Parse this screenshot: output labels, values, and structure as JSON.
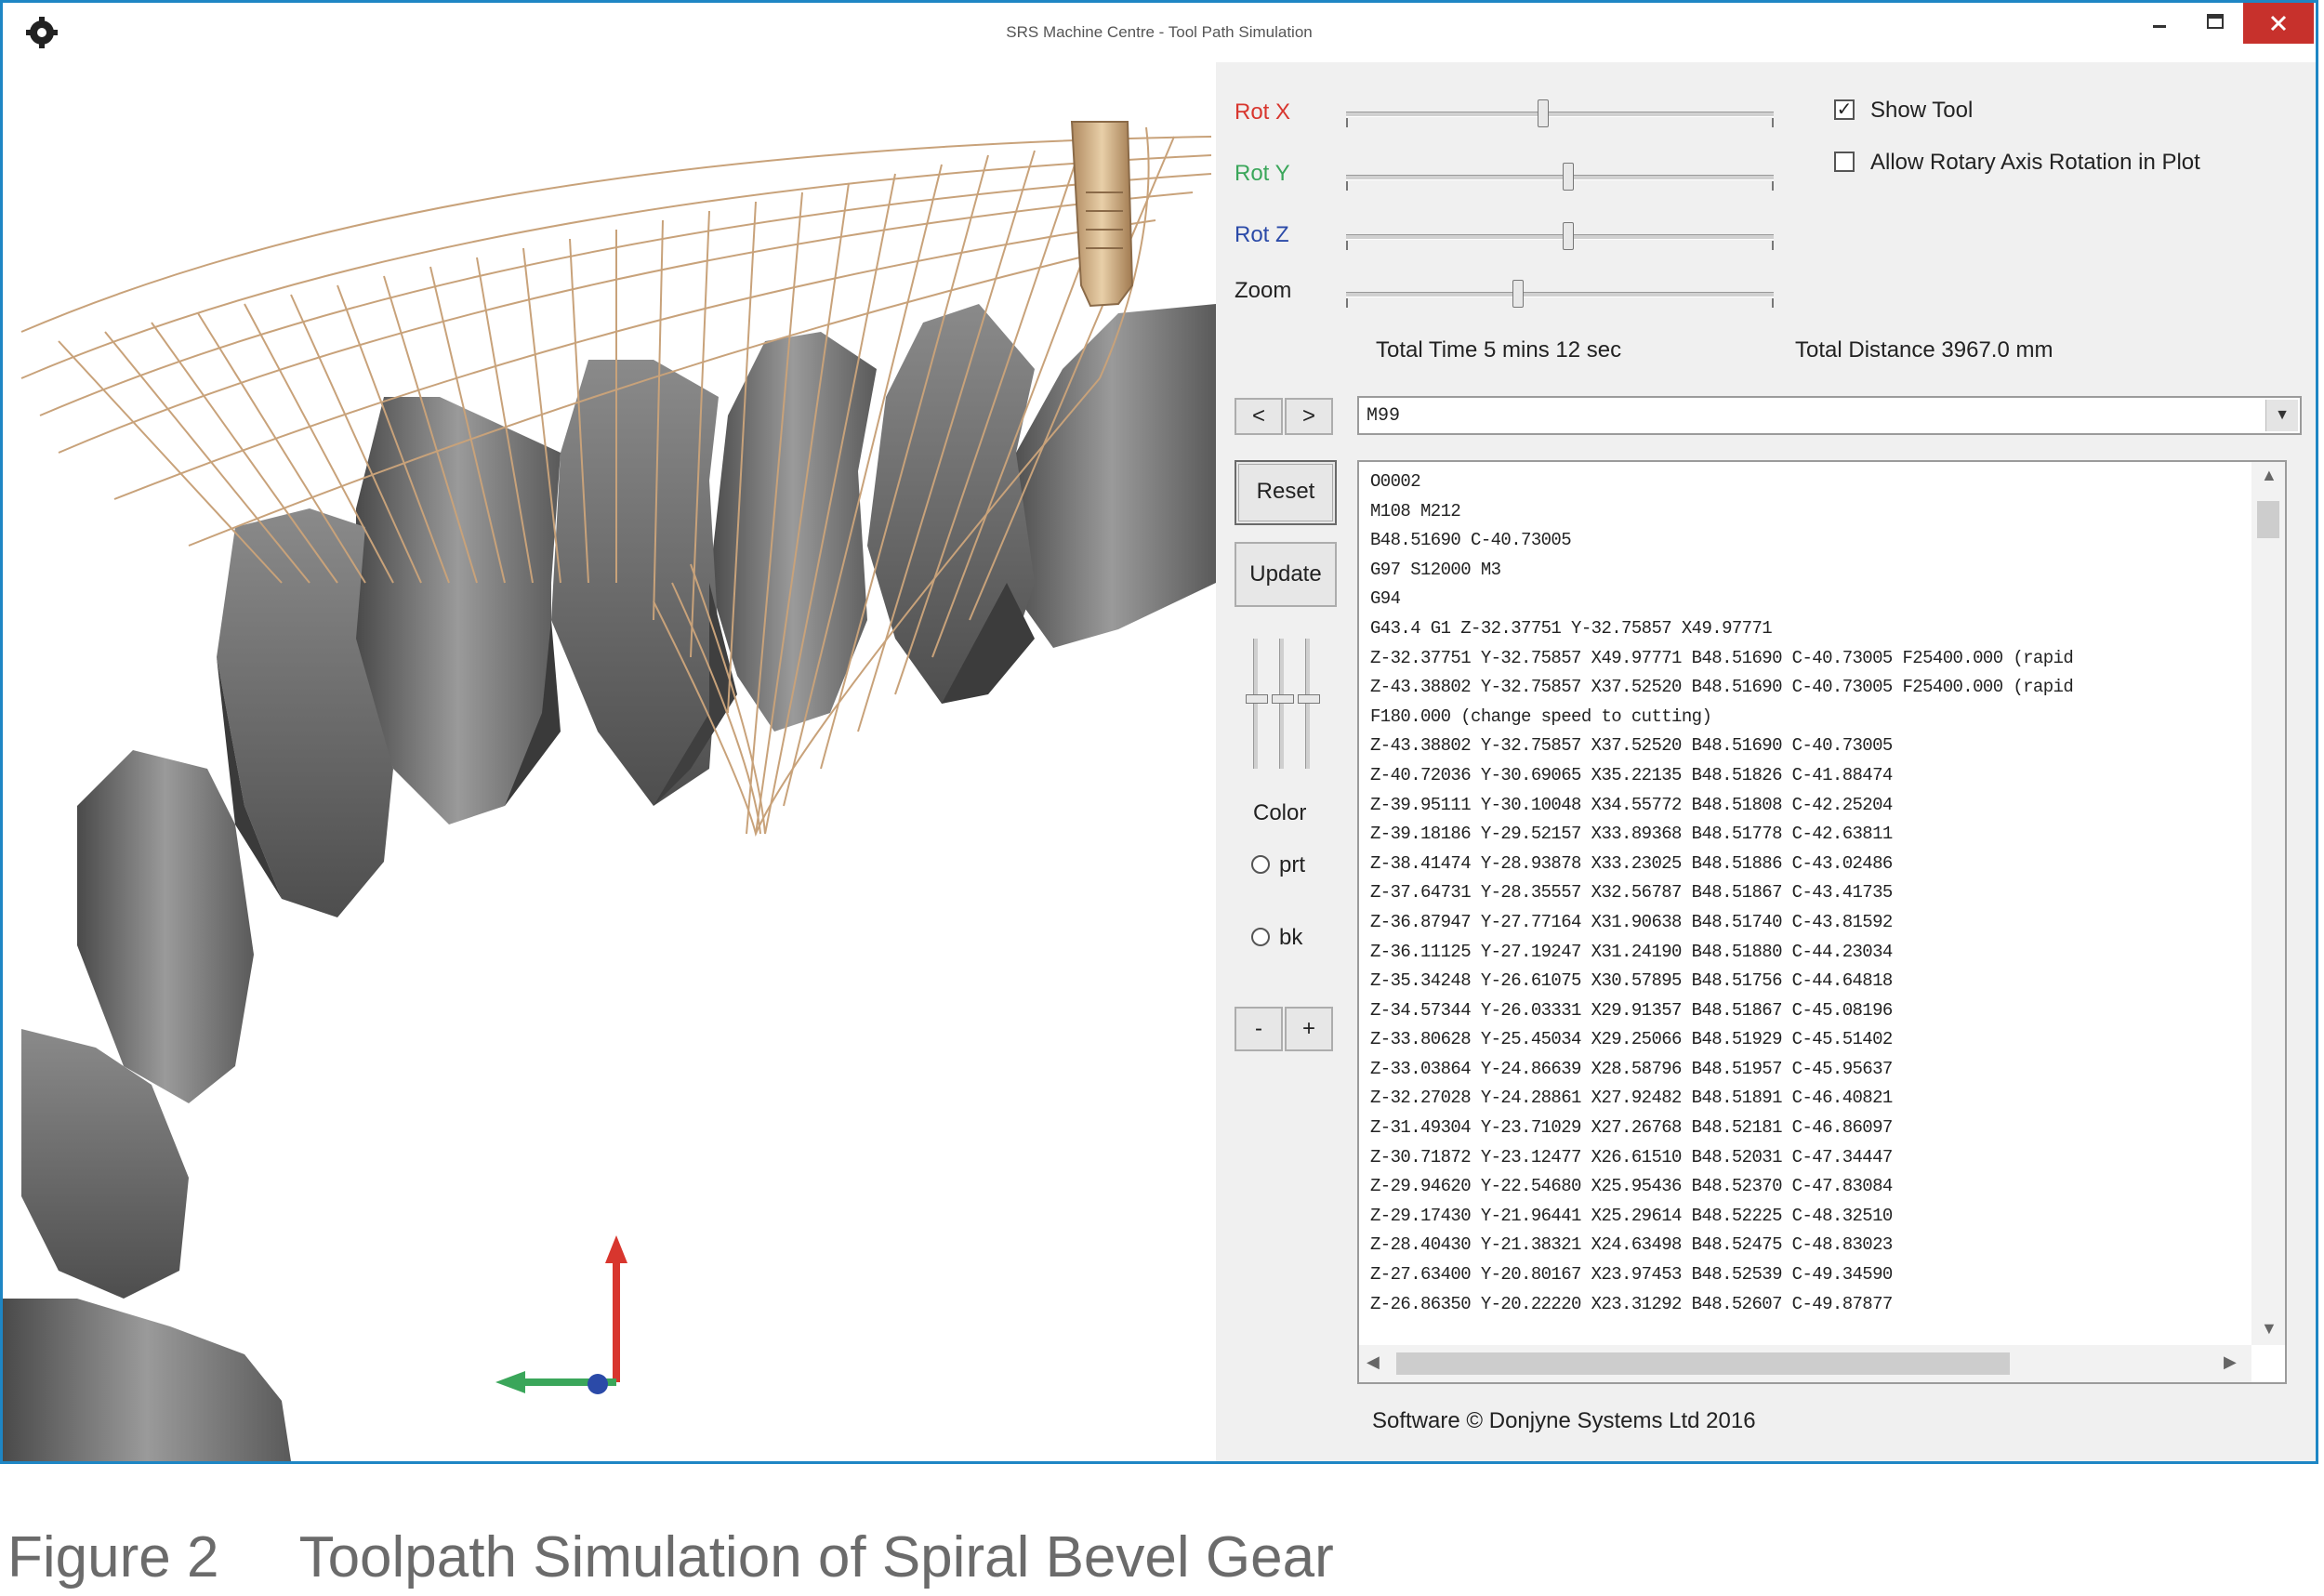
{
  "window": {
    "title": "SRS Machine Centre - Tool Path Simulation"
  },
  "controls": {
    "rot_x": {
      "label": "Rot X",
      "value": 0.46
    },
    "rot_y": {
      "label": "Rot Y",
      "value": 0.52
    },
    "rot_z": {
      "label": "Rot Z",
      "value": 0.52
    },
    "zoom": {
      "label": "Zoom",
      "value": 0.4
    },
    "show_tool": {
      "label": "Show Tool",
      "checked": true
    },
    "allow_rotary": {
      "label": "Allow Rotary Axis Rotation in Plot",
      "checked": false
    }
  },
  "stats": {
    "total_time": "Total Time 5 mins 12 sec",
    "total_distance": "Total Distance 3967.0 mm"
  },
  "nav": {
    "prev": "<",
    "next": ">"
  },
  "buttons": {
    "reset": "Reset",
    "update": "Update",
    "minus": "-",
    "plus": "+"
  },
  "color": {
    "label": "Color",
    "options": [
      {
        "label": "prt",
        "selected": false
      },
      {
        "label": "bk",
        "selected": false
      }
    ]
  },
  "line_select": {
    "value": "M99"
  },
  "gcode_lines": [
    "O0002",
    "M108 M212",
    "B48.51690 C-40.73005",
    "G97 S12000 M3",
    "G94",
    "G43.4 G1 Z-32.37751 Y-32.75857 X49.97771",
    "Z-32.37751 Y-32.75857 X49.97771 B48.51690 C-40.73005 F25400.000 (rapid",
    "Z-43.38802 Y-32.75857 X37.52520 B48.51690 C-40.73005 F25400.000 (rapid",
    "F180.000 (change speed to cutting)",
    "Z-43.38802 Y-32.75857 X37.52520 B48.51690 C-40.73005",
    "Z-40.72036 Y-30.69065 X35.22135 B48.51826 C-41.88474",
    "Z-39.95111 Y-30.10048 X34.55772 B48.51808 C-42.25204",
    "Z-39.18186 Y-29.52157 X33.89368 B48.51778 C-42.63811",
    "Z-38.41474 Y-28.93878 X33.23025 B48.51886 C-43.02486",
    "Z-37.64731 Y-28.35557 X32.56787 B48.51867 C-43.41735",
    "Z-36.87947 Y-27.77164 X31.90638 B48.51740 C-43.81592",
    "Z-36.11125 Y-27.19247 X31.24190 B48.51880 C-44.23034",
    "Z-35.34248 Y-26.61075 X30.57895 B48.51756 C-44.64818",
    "Z-34.57344 Y-26.03331 X29.91357 B48.51867 C-45.08196",
    "Z-33.80628 Y-25.45034 X29.25066 B48.51929 C-45.51402",
    "Z-33.03864 Y-24.86639 X28.58796 B48.51957 C-45.95637",
    "Z-32.27028 Y-24.28861 X27.92482 B48.51891 C-46.40821",
    "Z-31.49304 Y-23.71029 X27.26768 B48.52181 C-46.86097",
    "Z-30.71872 Y-23.12477 X26.61510 B48.52031 C-47.34447",
    "Z-29.94620 Y-22.54680 X25.95436 B48.52370 C-47.83084",
    "Z-29.17430 Y-21.96441 X25.29614 B48.52225 C-48.32510",
    "Z-28.40430 Y-21.38321 X24.63498 B48.52475 C-48.83023",
    "Z-27.63400 Y-20.80167 X23.97453 B48.52539 C-49.34590",
    "Z-26.86350 Y-20.22220 X23.31292 B48.52607 C-49.87877"
  ],
  "footer": {
    "copyright": "Software © Donjyne Systems Ltd 2016"
  },
  "caption": {
    "figure": "Figure 2",
    "text": "Toolpath Simulation of Spiral Bevel Gear"
  },
  "colors": {
    "window_border": "#1e86c4",
    "panel_bg": "#f0f0f0",
    "gear_steel": "#6e6e6e",
    "toolpath": "#c8a27a",
    "close_button": "#c7312c",
    "axis_x": "#d8362e",
    "axis_y": "#3aa65a",
    "axis_z": "#2b4aa8"
  }
}
